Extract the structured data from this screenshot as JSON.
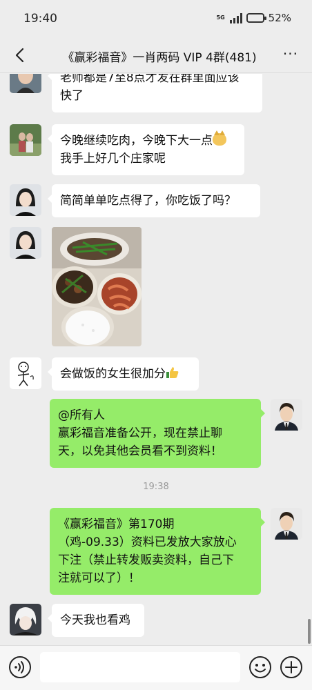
{
  "status_bar": {
    "time": "19:40",
    "network": "5G",
    "battery": "52%",
    "battery_level": 0.52
  },
  "header": {
    "title": "《赢彩福音》一肖两码 VIP 4群(481)",
    "more_icon": "more-icon"
  },
  "messages": [
    {
      "side": "left",
      "avatar": "avatar-man",
      "lines": [
        "老师都是7至8点才发在群里面应该",
        "快了"
      ]
    },
    {
      "side": "left",
      "avatar": "avatar-couple",
      "lines": [
        "今晚继续吃肉，今晚下大一点",
        "我手上好几个庄家呢"
      ]
    },
    {
      "side": "left",
      "avatar": "avatar-woman",
      "lines": [
        "简简单单吃点得了，你吃饭了吗？"
      ]
    },
    {
      "side": "left",
      "avatar": "avatar-woman",
      "type": "image",
      "image_desc": "food-photo"
    },
    {
      "side": "left",
      "avatar": "avatar-doodle",
      "lines": [
        "会做饭的女生很加分"
      ]
    },
    {
      "side": "right",
      "avatar": "avatar-suit",
      "lines": [
        "@所有人",
        "赢彩福音准备公开，现在禁止聊",
        "天，以免其他会员看不到资料！"
      ]
    },
    {
      "side": "right",
      "avatar": "avatar-suit",
      "lines": [
        "《赢彩福音》第170期",
        "（鸡-09.33）资料已发放大家放心",
        "下注（禁止转发贩卖资料，自己下",
        "注就可以了）！"
      ]
    },
    {
      "side": "left",
      "avatar": "avatar-anime",
      "lines": [
        "今天我也看鸡"
      ]
    }
  ],
  "timestamp": "19:38",
  "input": {
    "placeholder": "",
    "value": ""
  }
}
